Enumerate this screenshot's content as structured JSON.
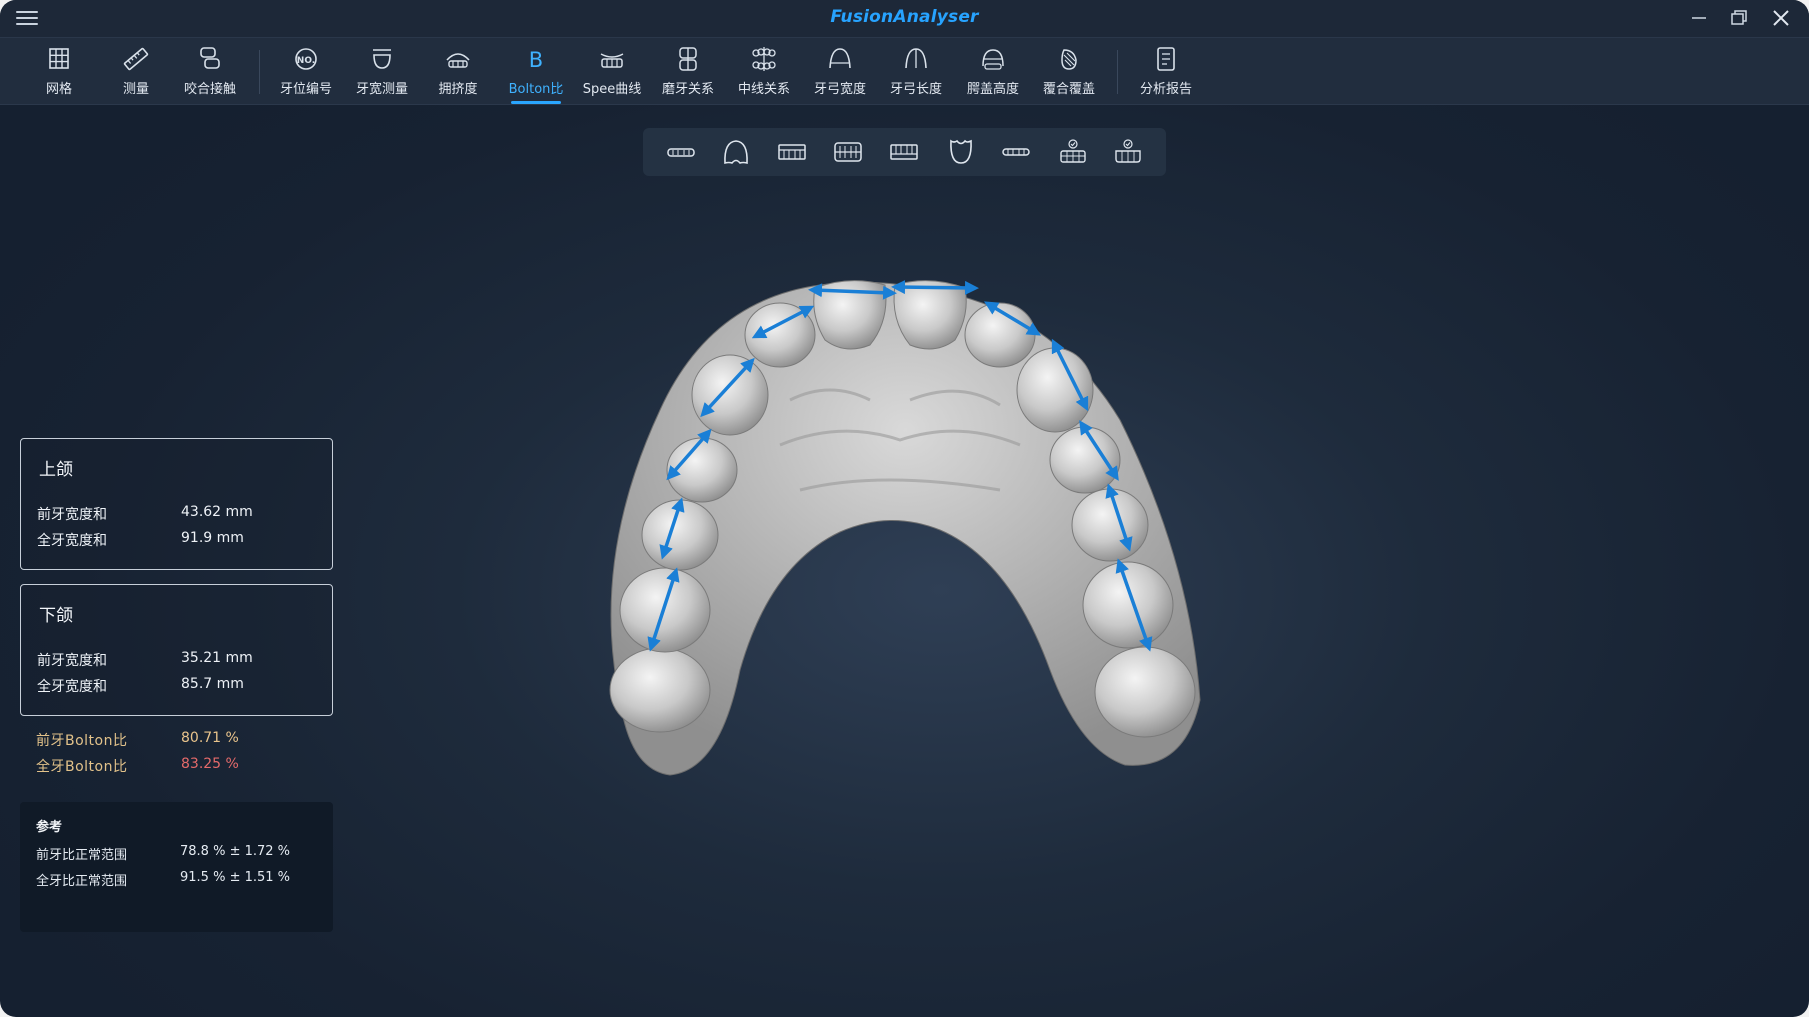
{
  "app": {
    "title": "FusionAnalyser"
  },
  "toolbar": {
    "items": [
      {
        "label": "网格",
        "icon": "grid-icon"
      },
      {
        "label": "测量",
        "icon": "ruler-icon"
      },
      {
        "label": "咬合接触",
        "icon": "occlusal-contact-icon"
      },
      {
        "label": "牙位编号",
        "icon": "tooth-number-icon"
      },
      {
        "label": "牙宽测量",
        "icon": "tooth-width-icon"
      },
      {
        "label": "拥挤度",
        "icon": "crowding-icon"
      },
      {
        "label": "Bolton比",
        "icon": "bolton-icon",
        "active": true
      },
      {
        "label": "Spee曲线",
        "icon": "spee-curve-icon"
      },
      {
        "label": "磨牙关系",
        "icon": "molar-relation-icon"
      },
      {
        "label": "中线关系",
        "icon": "midline-icon"
      },
      {
        "label": "牙弓宽度",
        "icon": "arch-width-icon"
      },
      {
        "label": "牙弓长度",
        "icon": "arch-length-icon"
      },
      {
        "label": "腭盖高度",
        "icon": "palate-height-icon"
      },
      {
        "label": "覆合覆盖",
        "icon": "overbite-icon"
      },
      {
        "label": "分析报告",
        "icon": "report-icon"
      }
    ]
  },
  "subtoolbar": {
    "icons": [
      "front-view-icon",
      "arch-outline-icon",
      "upper-teeth-icon",
      "both-jaws-icon",
      "lower-teeth-icon",
      "lower-arch-icon",
      "side-view-icon",
      "upper-check-icon",
      "lower-check-icon"
    ]
  },
  "upper": {
    "title": "上颌",
    "front_label": "前牙宽度和",
    "front_value": "43.62 mm",
    "total_label": "全牙宽度和",
    "total_value": "91.9 mm"
  },
  "lower": {
    "title": "下颌",
    "front_label": "前牙宽度和",
    "front_value": "35.21 mm",
    "total_label": "全牙宽度和",
    "total_value": "85.7 mm"
  },
  "bolton": {
    "front_label": "前牙Bolton比",
    "front_value": "80.71 %",
    "front_color": "#e9c48c",
    "total_label": "全牙Bolton比",
    "total_value": "83.25 %",
    "total_color": "#e46a6a"
  },
  "reference": {
    "title": "参考",
    "front_label": "前牙比正常范围",
    "front_value": "78.8 % ± 1.72 %",
    "total_label": "全牙比正常范围",
    "total_value": "91.5 % ± 1.51 %"
  },
  "colors": {
    "accent": "#2aa6ff",
    "measure_arrow": "#1a7fd6"
  }
}
